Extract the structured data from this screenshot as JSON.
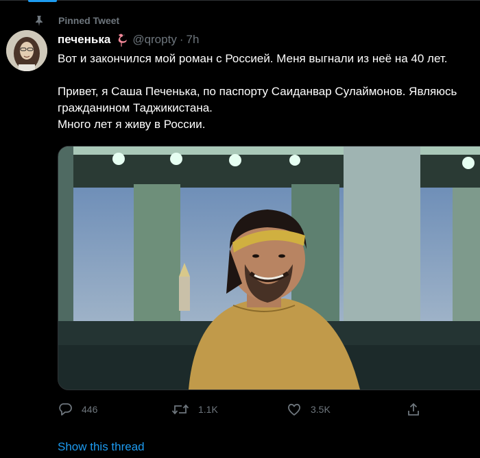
{
  "colors": {
    "background": "#000000",
    "accent": "#1d9bf0",
    "muted": "#6e767d",
    "text": "#ffffff"
  },
  "pinned": {
    "label": "Pinned Tweet",
    "icon": "pin-icon"
  },
  "tweet": {
    "display_name": "печенька",
    "name_emoji": "flamingo-icon",
    "handle": "@qropty",
    "separator": "·",
    "time": "7h",
    "lines": [
      "Вот и закончился мой роман с Россией. Меня выгнали из неё на 40 лет.",
      "",
      "Привет, я Саша Печенька, по паспорту Саиданвар Сулаймонов. Являюсь",
      "гражданином Таджикистана.",
      "Много лет я живу в России."
    ]
  },
  "actions": {
    "reply": {
      "icon": "reply-icon",
      "count": "446"
    },
    "retweet": {
      "icon": "retweet-icon",
      "count": "1.1K"
    },
    "like": {
      "icon": "heart-icon",
      "count": "3.5K"
    },
    "share": {
      "icon": "share-icon"
    }
  },
  "thread_link": "Show this thread"
}
